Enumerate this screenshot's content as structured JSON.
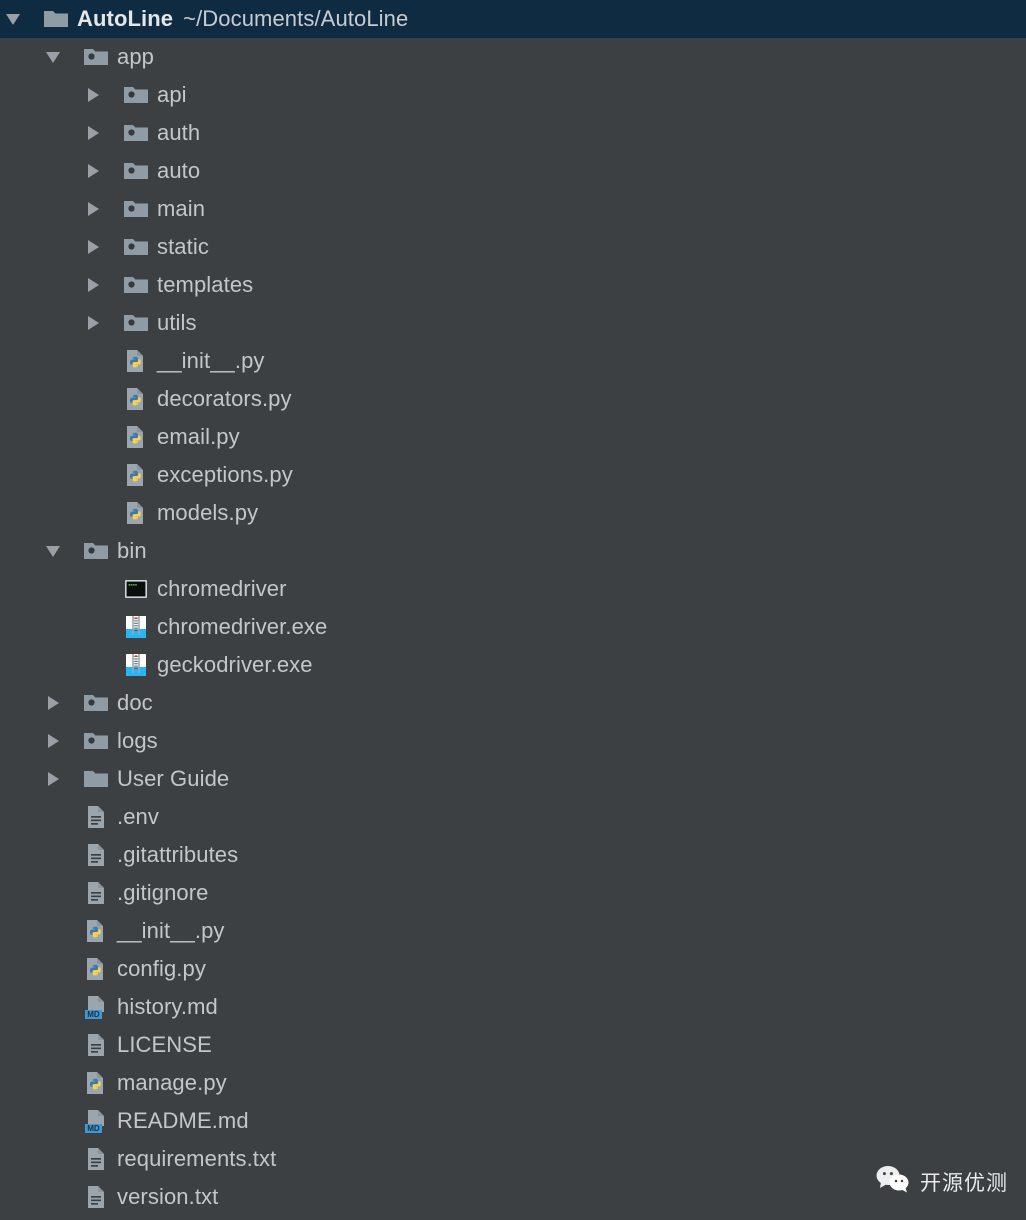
{
  "window": {
    "title": "AutoLine",
    "path": "~/Documents/AutoLine",
    "colors": {
      "background": "#3c4043",
      "selected_row": "#0f2b42",
      "text": "#c3c7ca",
      "folder_icon": "#8f9ba5",
      "python_blue": "#3c78a8",
      "python_yellow": "#ffd343",
      "md_badge": "#3d9bd4",
      "terminal_green": "#4caf50"
    }
  },
  "tree": [
    {
      "label": "AutoLine",
      "path": "~/Documents/AutoLine",
      "icon": "folder-plain-icon",
      "twisty": "down",
      "depth": 0,
      "selected": true,
      "root": true
    },
    {
      "label": "app",
      "icon": "folder-module-icon",
      "twisty": "down",
      "depth": 1
    },
    {
      "label": "api",
      "icon": "folder-module-icon",
      "twisty": "right",
      "depth": 2
    },
    {
      "label": "auth",
      "icon": "folder-module-icon",
      "twisty": "right",
      "depth": 2
    },
    {
      "label": "auto",
      "icon": "folder-module-icon",
      "twisty": "right",
      "depth": 2
    },
    {
      "label": "main",
      "icon": "folder-module-icon",
      "twisty": "right",
      "depth": 2
    },
    {
      "label": "static",
      "icon": "folder-module-icon",
      "twisty": "right",
      "depth": 2
    },
    {
      "label": "templates",
      "icon": "folder-module-icon",
      "twisty": "right",
      "depth": 2
    },
    {
      "label": "utils",
      "icon": "folder-module-icon",
      "twisty": "right",
      "depth": 2
    },
    {
      "label": "__init__.py",
      "icon": "python-file-icon",
      "twisty": "none",
      "depth": 2
    },
    {
      "label": "decorators.py",
      "icon": "python-file-icon",
      "twisty": "none",
      "depth": 2
    },
    {
      "label": "email.py",
      "icon": "python-file-icon",
      "twisty": "none",
      "depth": 2
    },
    {
      "label": "exceptions.py",
      "icon": "python-file-icon",
      "twisty": "none",
      "depth": 2
    },
    {
      "label": "models.py",
      "icon": "python-file-icon",
      "twisty": "none",
      "depth": 2
    },
    {
      "label": "bin",
      "icon": "folder-module-icon",
      "twisty": "down",
      "depth": 1
    },
    {
      "label": "chromedriver",
      "icon": "terminal-icon",
      "twisty": "none",
      "depth": 2
    },
    {
      "label": "chromedriver.exe",
      "icon": "executable-icon",
      "twisty": "none",
      "depth": 2
    },
    {
      "label": "geckodriver.exe",
      "icon": "executable-icon",
      "twisty": "none",
      "depth": 2
    },
    {
      "label": "doc",
      "icon": "folder-module-icon",
      "twisty": "right",
      "depth": 1
    },
    {
      "label": "logs",
      "icon": "folder-module-icon",
      "twisty": "right",
      "depth": 1
    },
    {
      "label": "User Guide",
      "icon": "folder-plain-icon",
      "twisty": "right",
      "depth": 1
    },
    {
      "label": ".env",
      "icon": "text-file-icon",
      "twisty": "none",
      "depth": 1
    },
    {
      "label": ".gitattributes",
      "icon": "text-file-icon",
      "twisty": "none",
      "depth": 1
    },
    {
      "label": ".gitignore",
      "icon": "text-file-icon",
      "twisty": "none",
      "depth": 1
    },
    {
      "label": "__init__.py",
      "icon": "python-file-icon",
      "twisty": "none",
      "depth": 1
    },
    {
      "label": "config.py",
      "icon": "python-file-icon",
      "twisty": "none",
      "depth": 1
    },
    {
      "label": "history.md",
      "icon": "markdown-file-icon",
      "twisty": "none",
      "depth": 1
    },
    {
      "label": "LICENSE",
      "icon": "text-file-icon",
      "twisty": "none",
      "depth": 1
    },
    {
      "label": "manage.py",
      "icon": "python-file-icon",
      "twisty": "none",
      "depth": 1
    },
    {
      "label": "README.md",
      "icon": "markdown-file-icon",
      "twisty": "none",
      "depth": 1
    },
    {
      "label": "requirements.txt",
      "icon": "text-file-icon",
      "twisty": "none",
      "depth": 1
    },
    {
      "label": "version.txt",
      "icon": "text-file-icon",
      "twisty": "none",
      "depth": 1
    }
  ],
  "watermark": {
    "icon": "wechat-icon",
    "text": "开源优测"
  },
  "badges": {
    "markdown": "MD"
  }
}
